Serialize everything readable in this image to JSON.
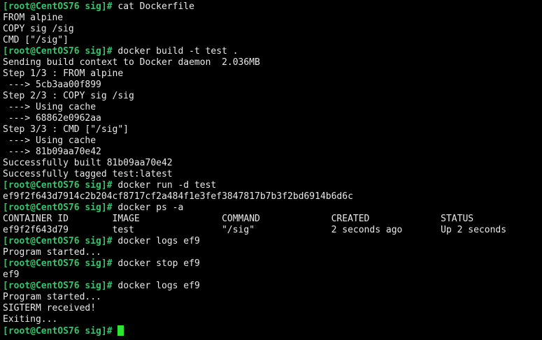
{
  "terminal": {
    "prompt": "[root@CentOS76 sig]# ",
    "lines": [
      {
        "type": "cmd",
        "text": "cat Dockerfile"
      },
      {
        "type": "out",
        "text": "FROM alpine"
      },
      {
        "type": "out",
        "text": "COPY sig /sig"
      },
      {
        "type": "out",
        "text": "CMD [\"/sig\"]"
      },
      {
        "type": "cmd",
        "text": "docker build -t test ."
      },
      {
        "type": "out",
        "text": "Sending build context to Docker daemon  2.036MB"
      },
      {
        "type": "out",
        "text": "Step 1/3 : FROM alpine"
      },
      {
        "type": "out",
        "text": " ---> 5cb3aa00f899"
      },
      {
        "type": "out",
        "text": "Step 2/3 : COPY sig /sig"
      },
      {
        "type": "out",
        "text": " ---> Using cache"
      },
      {
        "type": "out",
        "text": " ---> 68862e0962aa"
      },
      {
        "type": "out",
        "text": "Step 3/3 : CMD [\"/sig\"]"
      },
      {
        "type": "out",
        "text": " ---> Using cache"
      },
      {
        "type": "out",
        "text": " ---> 81b09aa70e42"
      },
      {
        "type": "out",
        "text": "Successfully built 81b09aa70e42"
      },
      {
        "type": "out",
        "text": "Successfully tagged test:latest"
      },
      {
        "type": "cmd",
        "text": "docker run -d test"
      },
      {
        "type": "out",
        "text": "ef9f2f643d7914c2b204cf8717cf2a484f1e3fef3847817b7b3f2bd6914b6d6c"
      },
      {
        "type": "cmd",
        "text": "docker ps -a"
      },
      {
        "type": "out",
        "text": "CONTAINER ID        IMAGE               COMMAND             CREATED             STATUS"
      },
      {
        "type": "out",
        "text": "ef9f2f643d79        test                \"/sig\"              2 seconds ago       Up 2 seconds"
      },
      {
        "type": "cmd",
        "text": "docker logs ef9"
      },
      {
        "type": "out",
        "text": "Program started..."
      },
      {
        "type": "cmd",
        "text": "docker stop ef9"
      },
      {
        "type": "out",
        "text": "ef9"
      },
      {
        "type": "cmd",
        "text": "docker logs ef9"
      },
      {
        "type": "out",
        "text": "Program started..."
      },
      {
        "type": "out",
        "text": "SIGTERM received!"
      },
      {
        "type": "out",
        "text": "Exiting..."
      },
      {
        "type": "cursor",
        "text": ""
      }
    ]
  },
  "colors": {
    "background": "#000000",
    "prompt": "#36c36a",
    "text": "#e8e8e8",
    "cursor": "#2ee62e"
  }
}
